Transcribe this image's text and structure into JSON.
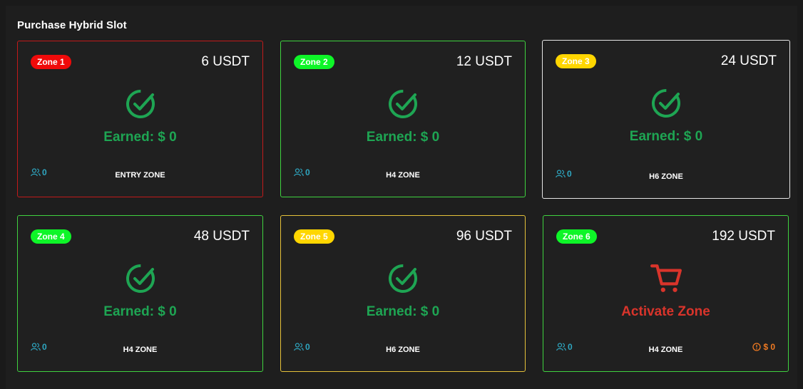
{
  "section": {
    "title": "Purchase Hybrid Slot"
  },
  "colors": {
    "red": "#f00a0a",
    "green": "#0ef528",
    "yellow": "#ffd600",
    "earned": "#1ea553",
    "activate": "#d9342b",
    "members": "#2ea6c0",
    "warn": "#f07a22"
  },
  "cards": [
    {
      "badge": "Zone 1",
      "badge_color": "red",
      "border_color": "#c21a1a",
      "price": "6 USDT",
      "icon": "check-circle-icon",
      "status": "Earned: $ 0",
      "members": "0",
      "zone": "ENTRY ZONE"
    },
    {
      "badge": "Zone 2",
      "badge_color": "green",
      "border_color": "#3fd23f",
      "price": "12 USDT",
      "icon": "check-circle-icon",
      "status": "Earned: $ 0",
      "members": "0",
      "zone": "H4 ZONE"
    },
    {
      "badge": "Zone 3",
      "badge_color": "yellow",
      "border_color": "#e6e6e6",
      "price": "24 USDT",
      "icon": "check-circle-icon",
      "status": "Earned: $ 0",
      "members": "0",
      "zone": "H6 ZONE"
    },
    {
      "badge": "Zone 4",
      "badge_color": "green",
      "border_color": "#3fd23f",
      "price": "48 USDT",
      "icon": "check-circle-icon",
      "status": "Earned: $ 0",
      "members": "0",
      "zone": "H4 ZONE"
    },
    {
      "badge": "Zone 5",
      "badge_color": "yellow",
      "border_color": "#e6c23a",
      "price": "96 USDT",
      "icon": "check-circle-icon",
      "status": "Earned: $ 0",
      "members": "0",
      "zone": "H6 ZONE"
    },
    {
      "badge": "Zone 6",
      "badge_color": "green",
      "border_color": "#3fd23f",
      "price": "192 USDT",
      "icon": "cart-icon",
      "status": "Activate Zone",
      "members": "0",
      "zone": "H4 ZONE",
      "warn": "$ 0"
    }
  ]
}
